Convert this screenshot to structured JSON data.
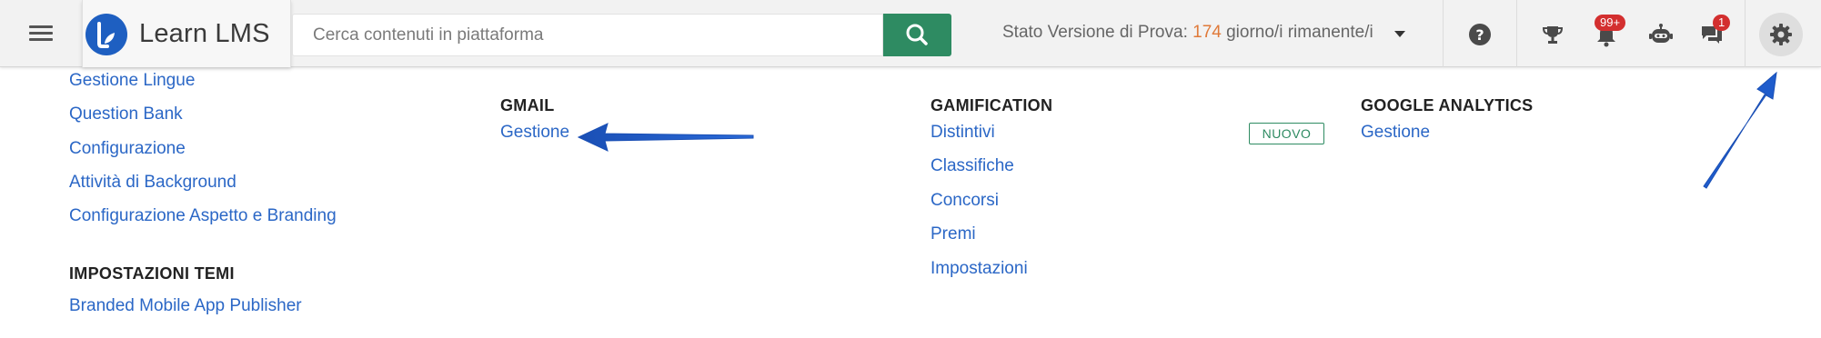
{
  "header": {
    "brand_name": "Learn LMS",
    "search": {
      "placeholder": "Cerca contenuti in piattaforma",
      "value": ""
    },
    "trial": {
      "prefix": "Stato Versione di Prova: ",
      "days": "174",
      "suffix": " giorno/i rimanente/i"
    },
    "notifications_badge": "99+",
    "messages_badge": "1",
    "colors": {
      "search_button": "#2e8b62",
      "brand_logo": "#1e5fc1",
      "badge": "#d32f2f",
      "trial_days": "#e07a3a",
      "link": "#2b67c6"
    },
    "icons": [
      "menu-icon",
      "learn-logo",
      "search-icon",
      "caret-down-icon",
      "help-icon",
      "trophy-icon",
      "bell-icon",
      "robot-icon",
      "chat-icon",
      "gear-icon"
    ]
  },
  "menu": {
    "col1": {
      "links": [
        "Gestione Lingue",
        "Question Bank",
        "Configurazione",
        "Attività di Background",
        "Configurazione Aspetto e Branding"
      ],
      "section2_title": "IMPOSTAZIONI TEMI",
      "section2_links": [
        "Branded Mobile App Publisher"
      ]
    },
    "gmail": {
      "title": "GMAIL",
      "links": [
        "Gestione"
      ]
    },
    "gamification": {
      "title": "GAMIFICATION",
      "links": [
        "Distintivi",
        "Classifiche",
        "Concorsi",
        "Premi",
        "Impostazioni"
      ],
      "new_label": "NUOVO"
    },
    "analytics": {
      "title": "GOOGLE ANALYTICS",
      "links": [
        "Gestione"
      ]
    }
  }
}
